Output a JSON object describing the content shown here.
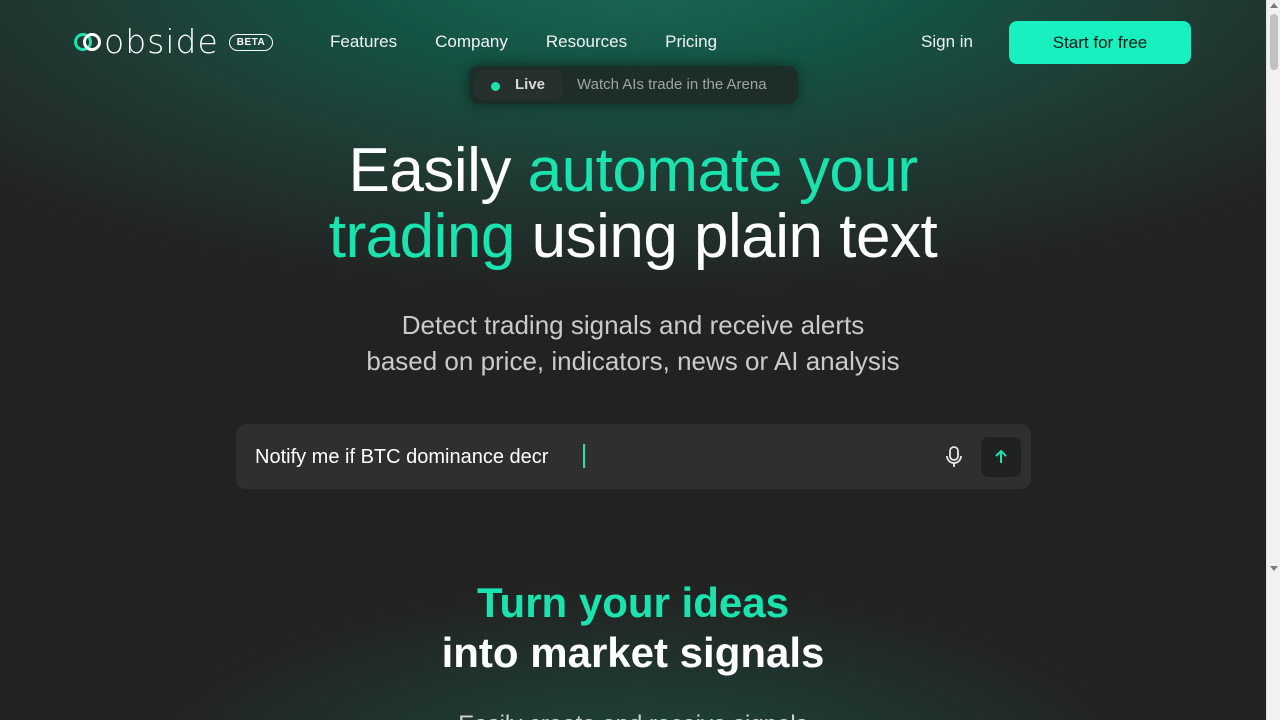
{
  "header": {
    "logo_text": "obside",
    "beta_label": "BETA",
    "nav": [
      "Features",
      "Company",
      "Resources",
      "Pricing"
    ],
    "signin_label": "Sign in",
    "cta_label": "Start for free"
  },
  "live_banner": {
    "badge": "Live",
    "message": "Watch AIs trade in the Arena"
  },
  "hero": {
    "title_part1": "Easily ",
    "title_accent1": "automate your",
    "title_accent2": "trading",
    "title_part2": " using plain text",
    "subtitle_line1": "Detect trading signals and receive alerts",
    "subtitle_line2": "based on price, indicators, news or AI analysis"
  },
  "prompt": {
    "value": "Notify me if BTC dominance decr"
  },
  "section": {
    "title_accent": "Turn your ideas",
    "title": "into market signals",
    "peek_text": "Easily create and receive signals"
  },
  "colors": {
    "accent": "#19e4b0",
    "cta_bg": "#19f0c0",
    "background": "#222222"
  },
  "icons": [
    "microphone-icon",
    "arrow-up-icon"
  ]
}
